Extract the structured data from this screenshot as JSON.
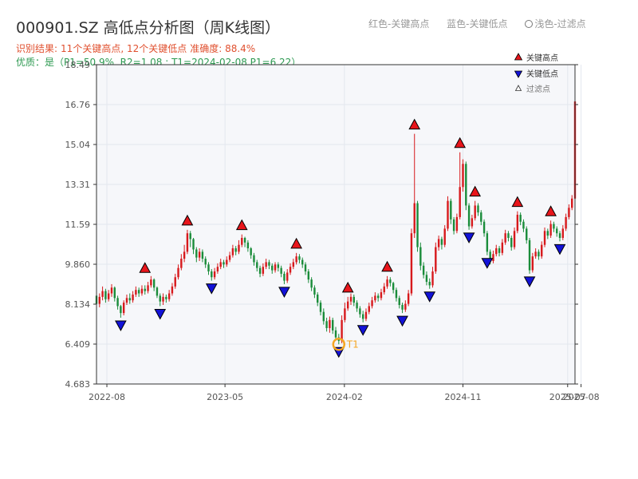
{
  "header": {
    "title": "000901.SZ 高低点分析图（周K线图）",
    "legend_red": "红色-关键高点",
    "legend_blue": "蓝色-关键低点",
    "legend_light": "浅色-过滤点",
    "result_prefix": "识别结果:",
    "result_counts": "11个关键高点, 12个关键低点",
    "accuracy": "准确度: 88.4%",
    "quality": "优质：是（P1=50.9%, R2=1.08 ; T1=2024-02-08 P1=6.22）"
  },
  "colors": {
    "up": "#d7191c",
    "down": "#1a8c3a",
    "high": "#e8151b",
    "low": "#1212d8",
    "t1_ring": "#f5a623",
    "grid": "#e3e7ee",
    "plot_bg": "#f6f7fa"
  },
  "chart_data": {
    "type": "candlestick",
    "title": "000901.SZ 高低点分析图（周K线图）",
    "yticks": [
      "4.683",
      "6.409",
      "8.134",
      "9.860",
      "11.59",
      "13.31",
      "15.04",
      "16.76",
      "18.49"
    ],
    "ylim": [
      4.683,
      18.49
    ],
    "x_start": "2022-07-08",
    "x_end": "2025-07-18",
    "xticks": [
      {
        "date": "2022-08-01",
        "label": "2022-08"
      },
      {
        "date": "2023-05-01",
        "label": "2023-05"
      },
      {
        "date": "2024-02-01",
        "label": "2024-02"
      },
      {
        "date": "2024-11-01",
        "label": "2024-11"
      },
      {
        "date": "2025-07-01",
        "label": "2025-07"
      },
      {
        "date": "2025-08-01",
        "label": "2025-08"
      }
    ],
    "grid": true,
    "candles": [
      [
        "2022-07-08",
        8.5,
        8.15,
        8.95,
        8.05
      ],
      [
        "2022-07-15",
        8.15,
        8.45,
        8.6,
        8.0
      ],
      [
        "2022-07-22",
        8.45,
        8.7,
        8.9,
        8.3
      ],
      [
        "2022-07-29",
        8.7,
        8.35,
        8.8,
        8.2
      ],
      [
        "2022-08-05",
        8.35,
        8.6,
        8.75,
        8.25
      ],
      [
        "2022-08-12",
        8.6,
        8.85,
        9.0,
        8.45
      ],
      [
        "2022-08-19",
        8.85,
        8.4,
        8.9,
        8.25
      ],
      [
        "2022-08-26",
        8.4,
        8.05,
        8.5,
        7.9
      ],
      [
        "2022-09-02",
        8.05,
        7.75,
        8.1,
        7.55
      ],
      [
        "2022-09-09",
        7.75,
        8.2,
        8.3,
        7.65
      ],
      [
        "2022-09-16",
        8.2,
        8.4,
        8.55,
        8.1
      ],
      [
        "2022-09-23",
        8.4,
        8.3,
        8.6,
        8.15
      ],
      [
        "2022-09-30",
        8.3,
        8.55,
        8.7,
        8.2
      ],
      [
        "2022-10-07",
        8.55,
        8.75,
        8.9,
        8.45
      ],
      [
        "2022-10-14",
        8.75,
        8.6,
        8.85,
        8.45
      ],
      [
        "2022-10-21",
        8.6,
        8.8,
        8.95,
        8.5
      ],
      [
        "2022-10-28",
        8.8,
        8.7,
        8.95,
        8.55
      ],
      [
        "2022-11-04",
        8.7,
        8.95,
        9.1,
        8.6
      ],
      [
        "2022-11-11",
        8.95,
        9.2,
        9.35,
        8.85
      ],
      [
        "2022-11-18",
        9.2,
        8.85,
        9.25,
        8.7
      ],
      [
        "2022-11-25",
        8.85,
        8.5,
        8.9,
        8.4
      ],
      [
        "2022-12-02",
        8.5,
        8.25,
        8.6,
        8.05
      ],
      [
        "2022-12-09",
        8.25,
        8.45,
        8.6,
        8.1
      ],
      [
        "2022-12-16",
        8.45,
        8.35,
        8.55,
        8.2
      ],
      [
        "2022-12-23",
        8.35,
        8.6,
        8.75,
        8.25
      ],
      [
        "2022-12-30",
        8.6,
        8.9,
        9.05,
        8.5
      ],
      [
        "2023-01-06",
        8.9,
        9.3,
        9.45,
        8.8
      ],
      [
        "2023-01-13",
        9.3,
        9.7,
        9.85,
        9.2
      ],
      [
        "2023-01-20",
        9.7,
        10.1,
        10.3,
        9.6
      ],
      [
        "2023-01-27",
        10.1,
        10.4,
        10.7,
        9.95
      ],
      [
        "2023-02-03",
        10.4,
        11.2,
        11.35,
        10.3
      ],
      [
        "2023-02-10",
        11.2,
        10.95,
        11.3,
        10.6
      ],
      [
        "2023-02-17",
        10.95,
        10.5,
        11.0,
        10.3
      ],
      [
        "2023-02-24",
        10.5,
        10.15,
        10.6,
        9.95
      ],
      [
        "2023-03-03",
        10.15,
        10.4,
        10.55,
        10.0
      ],
      [
        "2023-03-10",
        10.4,
        10.1,
        10.5,
        9.95
      ],
      [
        "2023-03-17",
        10.1,
        9.85,
        10.2,
        9.7
      ],
      [
        "2023-03-24",
        9.85,
        9.55,
        9.95,
        9.4
      ],
      [
        "2023-03-31",
        9.55,
        9.3,
        9.65,
        9.15
      ],
      [
        "2023-04-07",
        9.3,
        9.55,
        9.7,
        9.2
      ],
      [
        "2023-04-14",
        9.55,
        9.75,
        9.9,
        9.45
      ],
      [
        "2023-04-21",
        9.75,
        9.95,
        10.1,
        9.65
      ],
      [
        "2023-04-28",
        9.95,
        9.85,
        10.05,
        9.7
      ],
      [
        "2023-05-05",
        9.85,
        10.05,
        10.2,
        9.75
      ],
      [
        "2023-05-12",
        10.05,
        10.25,
        10.4,
        9.95
      ],
      [
        "2023-05-19",
        10.25,
        10.55,
        10.7,
        10.15
      ],
      [
        "2023-05-26",
        10.55,
        10.4,
        10.65,
        10.25
      ],
      [
        "2023-06-02",
        10.4,
        10.7,
        10.9,
        10.3
      ],
      [
        "2023-06-09",
        10.7,
        11.0,
        11.15,
        10.6
      ],
      [
        "2023-06-16",
        11.0,
        10.8,
        11.05,
        10.6
      ],
      [
        "2023-06-23",
        10.8,
        10.55,
        10.9,
        10.4
      ],
      [
        "2023-06-30",
        10.55,
        10.25,
        10.6,
        10.1
      ],
      [
        "2023-07-07",
        10.25,
        9.95,
        10.35,
        9.8
      ],
      [
        "2023-07-14",
        9.95,
        9.7,
        10.05,
        9.55
      ],
      [
        "2023-07-21",
        9.7,
        9.45,
        9.8,
        9.3
      ],
      [
        "2023-07-28",
        9.45,
        9.75,
        9.9,
        9.35
      ],
      [
        "2023-08-04",
        9.75,
        9.95,
        10.1,
        9.65
      ],
      [
        "2023-08-11",
        9.95,
        9.8,
        10.05,
        9.65
      ],
      [
        "2023-08-18",
        9.8,
        9.6,
        9.9,
        9.45
      ],
      [
        "2023-08-25",
        9.6,
        9.85,
        9.95,
        9.5
      ],
      [
        "2023-09-01",
        9.85,
        9.7,
        9.95,
        9.55
      ],
      [
        "2023-09-08",
        9.7,
        9.45,
        9.8,
        9.3
      ],
      [
        "2023-09-15",
        9.45,
        9.15,
        9.55,
        9.0
      ],
      [
        "2023-09-22",
        9.15,
        9.5,
        9.65,
        9.05
      ],
      [
        "2023-09-29",
        9.5,
        9.75,
        9.9,
        9.4
      ],
      [
        "2023-10-06",
        9.75,
        9.95,
        10.1,
        9.65
      ],
      [
        "2023-10-13",
        9.95,
        10.2,
        10.35,
        9.85
      ],
      [
        "2023-10-20",
        10.2,
        10.05,
        10.3,
        9.9
      ],
      [
        "2023-10-27",
        10.05,
        9.85,
        10.15,
        9.7
      ],
      [
        "2023-11-03",
        9.85,
        9.55,
        9.95,
        9.4
      ],
      [
        "2023-11-10",
        9.55,
        9.2,
        9.65,
        9.05
      ],
      [
        "2023-11-17",
        9.2,
        8.85,
        9.3,
        8.7
      ],
      [
        "2023-11-24",
        8.85,
        8.55,
        8.95,
        8.4
      ],
      [
        "2023-12-01",
        8.55,
        8.2,
        8.65,
        8.05
      ],
      [
        "2023-12-08",
        8.2,
        7.8,
        8.3,
        7.65
      ],
      [
        "2023-12-15",
        7.8,
        7.4,
        7.95,
        7.25
      ],
      [
        "2023-12-22",
        7.4,
        7.1,
        7.55,
        6.95
      ],
      [
        "2023-12-29",
        7.1,
        7.45,
        7.6,
        6.9
      ],
      [
        "2024-01-05",
        7.45,
        7.0,
        7.55,
        6.85
      ],
      [
        "2024-01-12",
        7.0,
        6.7,
        7.15,
        6.55
      ],
      [
        "2024-01-19",
        6.7,
        6.55,
        6.85,
        6.4
      ],
      [
        "2024-01-26",
        6.55,
        7.45,
        7.65,
        6.45
      ],
      [
        "2024-02-02",
        7.45,
        7.95,
        8.2,
        7.35
      ],
      [
        "2024-02-09",
        7.95,
        8.25,
        8.45,
        7.85
      ],
      [
        "2024-02-16",
        8.25,
        8.45,
        8.6,
        8.1
      ],
      [
        "2024-02-23",
        8.45,
        8.2,
        8.55,
        8.05
      ],
      [
        "2024-03-01",
        8.2,
        7.95,
        8.3,
        7.8
      ],
      [
        "2024-03-08",
        7.95,
        7.7,
        8.05,
        7.55
      ],
      [
        "2024-03-15",
        7.7,
        7.5,
        7.85,
        7.35
      ],
      [
        "2024-03-22",
        7.5,
        7.8,
        7.95,
        7.4
      ],
      [
        "2024-03-29",
        7.8,
        8.05,
        8.2,
        7.7
      ],
      [
        "2024-04-05",
        8.05,
        8.3,
        8.45,
        7.95
      ],
      [
        "2024-04-12",
        8.3,
        8.5,
        8.65,
        8.2
      ],
      [
        "2024-04-19",
        8.5,
        8.4,
        8.6,
        8.25
      ],
      [
        "2024-04-26",
        8.4,
        8.65,
        8.8,
        8.3
      ],
      [
        "2024-05-03",
        8.65,
        8.9,
        9.05,
        8.55
      ],
      [
        "2024-05-10",
        8.9,
        9.2,
        9.35,
        8.8
      ],
      [
        "2024-05-17",
        9.2,
        9.05,
        9.3,
        8.9
      ],
      [
        "2024-05-24",
        9.05,
        8.75,
        9.1,
        8.6
      ],
      [
        "2024-05-31",
        8.75,
        8.4,
        8.85,
        8.25
      ],
      [
        "2024-06-07",
        8.4,
        8.1,
        8.5,
        7.95
      ],
      [
        "2024-06-14",
        8.1,
        7.9,
        8.2,
        7.75
      ],
      [
        "2024-06-21",
        7.9,
        8.15,
        8.3,
        7.8
      ],
      [
        "2024-06-28",
        8.15,
        8.6,
        8.75,
        8.05
      ],
      [
        "2024-07-05",
        8.6,
        11.2,
        11.4,
        8.5
      ],
      [
        "2024-07-12",
        11.2,
        12.5,
        15.5,
        11.0
      ],
      [
        "2024-07-19",
        12.5,
        10.6,
        12.6,
        10.4
      ],
      [
        "2024-07-26",
        10.6,
        9.8,
        10.8,
        9.6
      ],
      [
        "2024-08-02",
        9.8,
        9.4,
        9.95,
        9.25
      ],
      [
        "2024-08-09",
        9.4,
        9.1,
        9.55,
        8.95
      ],
      [
        "2024-08-16",
        9.1,
        8.95,
        9.25,
        8.8
      ],
      [
        "2024-08-23",
        8.95,
        9.55,
        9.75,
        8.85
      ],
      [
        "2024-08-30",
        9.55,
        10.6,
        10.8,
        9.45
      ],
      [
        "2024-09-06",
        10.6,
        10.95,
        11.1,
        10.45
      ],
      [
        "2024-09-13",
        10.95,
        10.7,
        11.05,
        10.5
      ],
      [
        "2024-09-20",
        10.7,
        11.4,
        11.55,
        10.6
      ],
      [
        "2024-09-27",
        11.4,
        12.6,
        12.8,
        11.3
      ],
      [
        "2024-10-04",
        12.6,
        11.8,
        12.7,
        11.6
      ],
      [
        "2024-10-11",
        11.8,
        11.3,
        11.9,
        11.15
      ],
      [
        "2024-10-18",
        11.3,
        11.9,
        12.05,
        11.2
      ],
      [
        "2024-10-25",
        11.9,
        13.2,
        14.7,
        11.8
      ],
      [
        "2024-11-01",
        13.2,
        14.2,
        14.4,
        13.0
      ],
      [
        "2024-11-08",
        14.2,
        12.4,
        14.3,
        12.2
      ],
      [
        "2024-11-15",
        12.4,
        11.5,
        12.5,
        11.35
      ],
      [
        "2024-11-22",
        11.5,
        11.85,
        12.0,
        11.4
      ],
      [
        "2024-11-29",
        11.85,
        12.4,
        12.6,
        11.75
      ],
      [
        "2024-12-06",
        12.4,
        12.1,
        12.5,
        11.95
      ],
      [
        "2024-12-13",
        12.1,
        11.7,
        12.2,
        11.55
      ],
      [
        "2024-12-20",
        11.7,
        11.2,
        11.8,
        11.05
      ],
      [
        "2024-12-27",
        11.2,
        10.4,
        11.3,
        10.25
      ],
      [
        "2025-01-03",
        10.4,
        10.0,
        10.5,
        9.85
      ],
      [
        "2025-01-10",
        10.0,
        10.3,
        10.45,
        9.9
      ],
      [
        "2025-01-17",
        10.3,
        10.55,
        10.7,
        10.2
      ],
      [
        "2025-01-24",
        10.55,
        10.35,
        10.65,
        10.2
      ],
      [
        "2025-01-31",
        10.35,
        10.8,
        10.95,
        10.25
      ],
      [
        "2025-02-07",
        10.8,
        11.2,
        11.35,
        10.7
      ],
      [
        "2025-02-14",
        11.2,
        11.0,
        11.3,
        10.85
      ],
      [
        "2025-02-21",
        11.0,
        10.6,
        11.1,
        10.45
      ],
      [
        "2025-02-28",
        10.6,
        11.3,
        11.45,
        10.5
      ],
      [
        "2025-03-07",
        11.3,
        12.0,
        12.15,
        11.2
      ],
      [
        "2025-03-14",
        12.0,
        11.7,
        12.1,
        11.55
      ],
      [
        "2025-03-21",
        11.7,
        11.4,
        11.8,
        11.25
      ],
      [
        "2025-03-28",
        11.4,
        10.9,
        11.5,
        10.75
      ],
      [
        "2025-04-04",
        10.9,
        9.6,
        11.0,
        9.45
      ],
      [
        "2025-04-11",
        9.6,
        10.2,
        10.35,
        9.5
      ],
      [
        "2025-04-18",
        10.2,
        10.4,
        10.55,
        10.1
      ],
      [
        "2025-04-25",
        10.4,
        10.2,
        10.5,
        10.05
      ],
      [
        "2025-05-02",
        10.2,
        10.7,
        10.85,
        10.1
      ],
      [
        "2025-05-09",
        10.7,
        11.3,
        11.45,
        10.6
      ],
      [
        "2025-05-16",
        11.3,
        11.1,
        11.4,
        10.95
      ],
      [
        "2025-05-23",
        11.1,
        11.6,
        11.75,
        11.0
      ],
      [
        "2025-05-30",
        11.6,
        11.4,
        11.7,
        11.25
      ],
      [
        "2025-06-06",
        11.4,
        11.2,
        11.5,
        11.05
      ],
      [
        "2025-06-13",
        11.2,
        11.0,
        11.3,
        10.85
      ],
      [
        "2025-06-20",
        11.0,
        11.4,
        11.55,
        10.9
      ],
      [
        "2025-06-27",
        11.4,
        11.9,
        12.05,
        11.3
      ],
      [
        "2025-07-04",
        11.9,
        12.3,
        12.45,
        11.8
      ],
      [
        "2025-07-11",
        12.3,
        12.7,
        12.85,
        12.2
      ],
      [
        "2025-07-18",
        12.7,
        16.9,
        17.0,
        12.6
      ]
    ],
    "highs": [
      {
        "date": "2022-10-28",
        "value": 9.3
      },
      {
        "date": "2023-02-03",
        "value": 11.35
      },
      {
        "date": "2023-06-09",
        "value": 11.15
      },
      {
        "date": "2023-10-13",
        "value": 10.35
      },
      {
        "date": "2024-02-09",
        "value": 8.45
      },
      {
        "date": "2024-05-10",
        "value": 9.35
      },
      {
        "date": "2024-07-12",
        "value": 15.5
      },
      {
        "date": "2024-10-25",
        "value": 14.7
      },
      {
        "date": "2024-11-29",
        "value": 12.6
      },
      {
        "date": "2025-03-07",
        "value": 12.15
      },
      {
        "date": "2025-05-23",
        "value": 11.75
      }
    ],
    "lows": [
      {
        "date": "2022-09-02",
        "value": 7.55
      },
      {
        "date": "2022-12-02",
        "value": 8.05
      },
      {
        "date": "2023-03-31",
        "value": 9.15
      },
      {
        "date": "2023-09-15",
        "value": 9.0
      },
      {
        "date": "2024-01-19",
        "value": 6.4
      },
      {
        "date": "2024-03-15",
        "value": 7.35
      },
      {
        "date": "2024-06-14",
        "value": 7.75
      },
      {
        "date": "2024-08-16",
        "value": 8.8
      },
      {
        "date": "2024-11-15",
        "value": 11.35
      },
      {
        "date": "2024-12-27",
        "value": 10.25
      },
      {
        "date": "2025-04-04",
        "value": 9.45
      },
      {
        "date": "2025-06-13",
        "value": 10.85
      }
    ],
    "t1_marker": {
      "date": "2024-01-19",
      "value": 6.4,
      "label": "T1"
    },
    "legend": {
      "high": "关键高点",
      "low": "关键低点",
      "filtered": "过滤点"
    }
  }
}
